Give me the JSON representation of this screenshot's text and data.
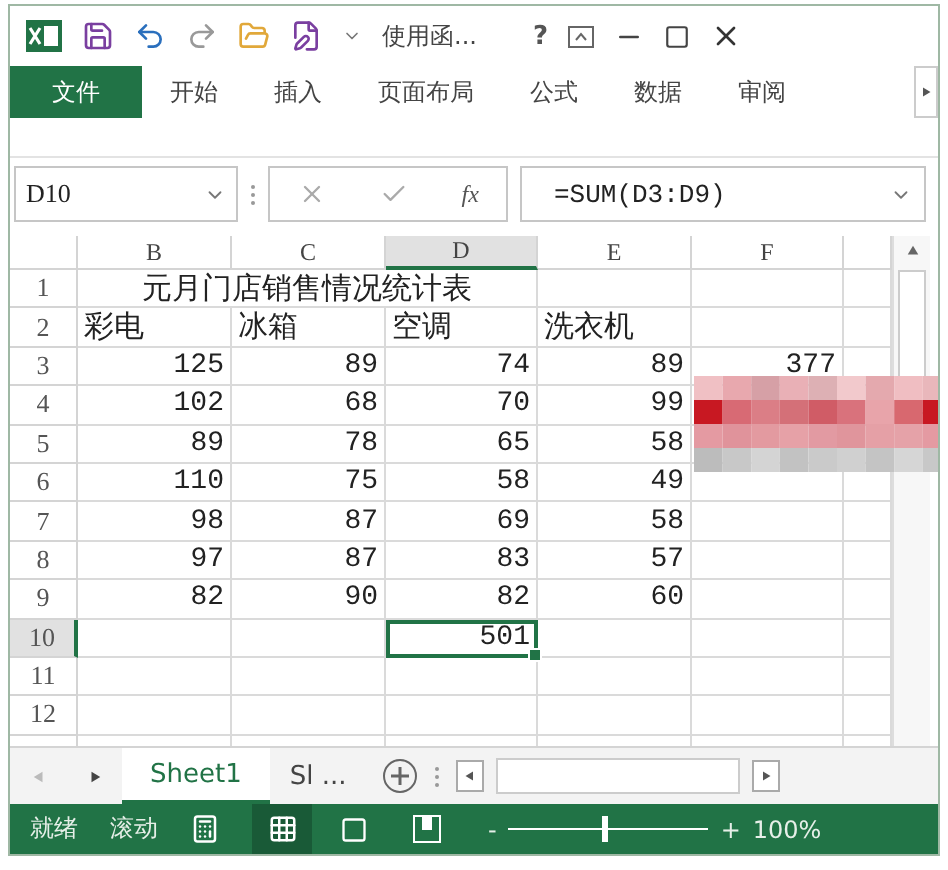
{
  "title_bar": {
    "title": "使用函...",
    "help": "?"
  },
  "ribbon_tabs": [
    {
      "label": "文件",
      "kind": "file",
      "selected": false
    },
    {
      "label": "开始",
      "kind": "tab",
      "selected": false
    },
    {
      "label": "插入",
      "kind": "tab",
      "selected": false
    },
    {
      "label": "页面布局",
      "kind": "tab",
      "selected": false
    },
    {
      "label": "公式",
      "kind": "tab",
      "selected": false
    },
    {
      "label": "数据",
      "kind": "tab",
      "selected": false
    },
    {
      "label": "审阅",
      "kind": "tab",
      "selected": false
    }
  ],
  "formula_bar": {
    "name_box": "D10",
    "function_label": "fx",
    "formula": "=SUM(D3:D9)"
  },
  "sheet": {
    "columns": [
      {
        "label": "B",
        "selected": false
      },
      {
        "label": "C",
        "selected": false
      },
      {
        "label": "D",
        "selected": true
      },
      {
        "label": "E",
        "selected": false
      },
      {
        "label": "F",
        "selected": false
      }
    ],
    "rows": [
      {
        "header": "1",
        "selected": false,
        "cells": [
          {
            "text": "元月门店销售情况统计表",
            "kind": "title",
            "selected": false
          },
          {
            "selected": false
          },
          {
            "selected": false
          }
        ]
      },
      {
        "header": "2",
        "selected": false,
        "cells": [
          {
            "text": "彩电",
            "kind": "text",
            "selected": false
          },
          {
            "text": "冰箱",
            "kind": "text",
            "selected": false
          },
          {
            "text": "空调",
            "kind": "text",
            "selected": false
          },
          {
            "text": "洗衣机",
            "kind": "text",
            "selected": false
          },
          {
            "selected": false
          }
        ]
      },
      {
        "header": "3",
        "selected": false,
        "cells": [
          {
            "text": "125",
            "kind": "number",
            "selected": false
          },
          {
            "text": "89",
            "kind": "number",
            "selected": false
          },
          {
            "text": "74",
            "kind": "number",
            "selected": false
          },
          {
            "text": "89",
            "kind": "number",
            "selected": false
          },
          {
            "text": "377",
            "kind": "number",
            "selected": false
          }
        ]
      },
      {
        "header": "4",
        "selected": false,
        "cells": [
          {
            "text": "102",
            "kind": "number",
            "selected": false
          },
          {
            "text": "68",
            "kind": "number",
            "selected": false
          },
          {
            "text": "70",
            "kind": "number",
            "selected": false
          },
          {
            "text": "99",
            "kind": "number",
            "selected": false
          },
          {
            "selected": false
          }
        ]
      },
      {
        "header": "5",
        "selected": false,
        "cells": [
          {
            "text": "89",
            "kind": "number",
            "selected": false
          },
          {
            "text": "78",
            "kind": "number",
            "selected": false
          },
          {
            "text": "65",
            "kind": "number",
            "selected": false
          },
          {
            "text": "58",
            "kind": "number",
            "selected": false
          },
          {
            "selected": false
          }
        ]
      },
      {
        "header": "6",
        "selected": false,
        "cells": [
          {
            "text": "110",
            "kind": "number",
            "selected": false
          },
          {
            "text": "75",
            "kind": "number",
            "selected": false
          },
          {
            "text": "58",
            "kind": "number",
            "selected": false
          },
          {
            "text": "49",
            "kind": "number",
            "selected": false
          },
          {
            "selected": false
          }
        ]
      },
      {
        "header": "7",
        "selected": false,
        "cells": [
          {
            "text": "98",
            "kind": "number",
            "selected": false
          },
          {
            "text": "87",
            "kind": "number",
            "selected": false
          },
          {
            "text": "69",
            "kind": "number",
            "selected": false
          },
          {
            "text": "58",
            "kind": "number",
            "selected": false
          },
          {
            "selected": false
          }
        ]
      },
      {
        "header": "8",
        "selected": false,
        "cells": [
          {
            "text": "97",
            "kind": "number",
            "selected": false
          },
          {
            "text": "87",
            "kind": "number",
            "selected": false
          },
          {
            "text": "83",
            "kind": "number",
            "selected": false
          },
          {
            "text": "57",
            "kind": "number",
            "selected": false
          },
          {
            "selected": false
          }
        ]
      },
      {
        "header": "9",
        "selected": false,
        "cells": [
          {
            "text": "82",
            "kind": "number",
            "selected": false
          },
          {
            "text": "90",
            "kind": "number",
            "selected": false
          },
          {
            "text": "82",
            "kind": "number",
            "selected": false
          },
          {
            "text": "60",
            "kind": "number",
            "selected": false
          },
          {
            "selected": false
          }
        ]
      },
      {
        "header": "10",
        "selected": true,
        "cells": [
          {
            "selected": false
          },
          {
            "selected": false
          },
          {
            "text": "501",
            "kind": "number",
            "selected": true
          },
          {
            "selected": false
          },
          {
            "selected": false
          }
        ]
      },
      {
        "header": "11",
        "selected": false,
        "cells": [
          {
            "selected": false
          },
          {
            "selected": false
          },
          {
            "selected": false
          },
          {
            "selected": false
          },
          {
            "selected": false
          }
        ]
      },
      {
        "header": "12",
        "selected": false,
        "cells": [
          {
            "selected": false
          },
          {
            "selected": false
          },
          {
            "selected": false
          },
          {
            "selected": false
          },
          {
            "selected": false
          }
        ]
      },
      {
        "selected": false,
        "cells": [
          {
            "selected": false
          },
          {
            "selected": false
          },
          {
            "selected": false
          },
          {
            "selected": false
          },
          {
            "selected": false
          }
        ]
      }
    ]
  },
  "sheet_tabs": [
    {
      "label": "Sheet1",
      "selected": true
    },
    {
      "label": "Sl ...",
      "selected": false
    }
  ],
  "status_bar": {
    "mode": "就绪",
    "scroll_lock": "滚动",
    "views": [
      {
        "kind": "normal",
        "selected": true
      },
      {
        "kind": "page_layout",
        "selected": false
      },
      {
        "kind": "page_break",
        "selected": false
      }
    ],
    "zoom": {
      "minus": "-",
      "plus": "+",
      "level": 0.5,
      "reading": "100%"
    }
  }
}
